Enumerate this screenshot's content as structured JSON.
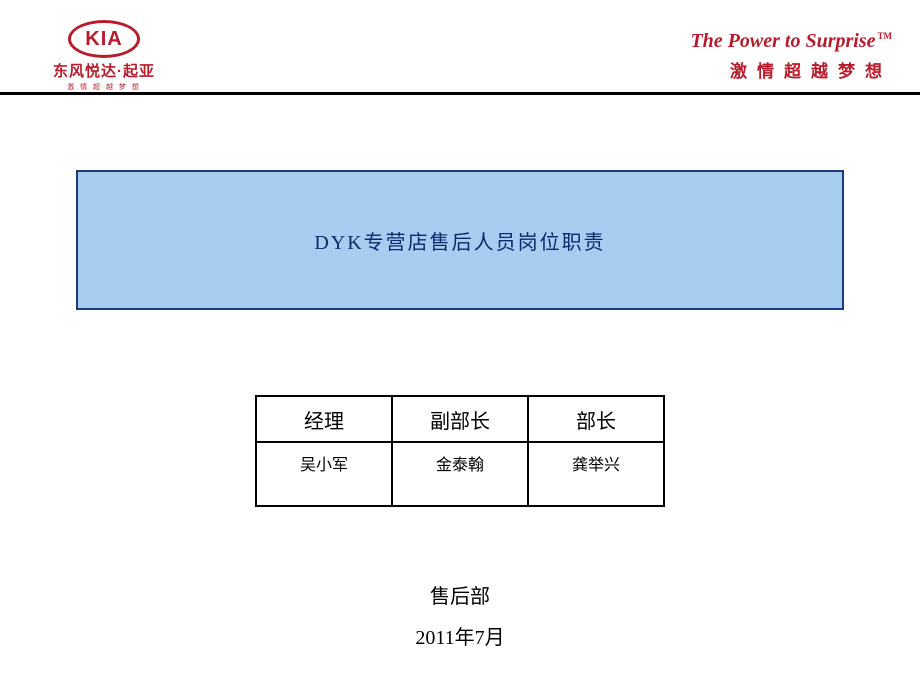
{
  "header": {
    "kia_logo_text": "KIA",
    "left_cn": "东风悦达·起亚",
    "left_sub": "激 情 超 越 梦 想",
    "right_en": "The Power to Surprise",
    "right_tm": "TM",
    "right_cn": "激情超越梦想"
  },
  "title": "DYK专营店售后人员岗位职责",
  "table": {
    "headers": [
      "经理",
      "副部长",
      "部长"
    ],
    "values": [
      "吴小军",
      "金泰翰",
      "龚举兴"
    ]
  },
  "footer": {
    "dept": "售后部",
    "date": "2011年7月"
  }
}
